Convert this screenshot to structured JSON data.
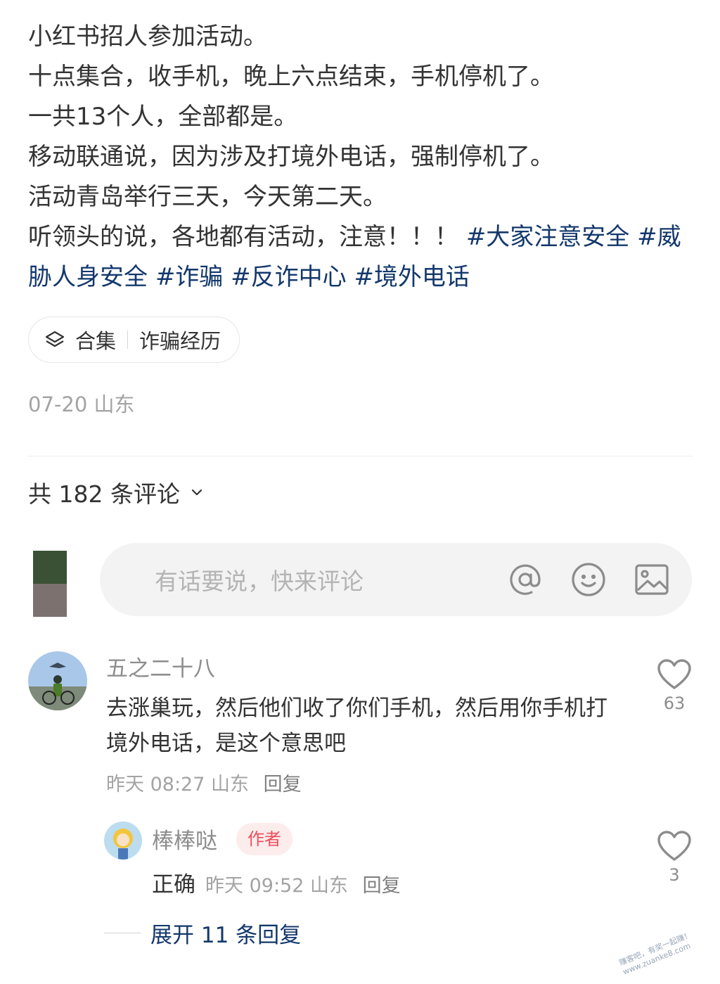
{
  "post": {
    "lines": [
      "小红书招人参加活动。",
      "十点集合，收手机，晚上六点结束，手机停机了。",
      "一共13个人，全部都是。",
      "移动联通说，因为涉及打境外电话，强制停机了。",
      "活动青岛举行三天，今天第二天。"
    ],
    "last_line_prefix": "听领头的说，各地都有活动，注意！！！ ",
    "hashtags": [
      "#大家注意安全",
      "#威胁人身安全",
      "#诈骗",
      "#反诈中心",
      "#境外电话"
    ]
  },
  "collection": {
    "icon": "layers-icon",
    "label": "合集",
    "name": "诈骗经历"
  },
  "meta": {
    "date": "07-20",
    "location": "山东"
  },
  "comments_header": {
    "label": "共 182 条评论"
  },
  "comment_input": {
    "placeholder": "有话要说，快来评论",
    "icons": [
      "at-icon",
      "emoji-icon",
      "image-icon"
    ]
  },
  "comment": {
    "username": "五之二十八",
    "text": "去涨巢玩，然后他们收了你们手机，然后用你手机打境外电话，是这个意思吧",
    "time": "昨天 08:27",
    "location": "山东",
    "reply_label": "回复",
    "likes": "63"
  },
  "reply": {
    "username": "棒棒哒",
    "badge": "作者",
    "text": "正确",
    "time": "昨天 09:52",
    "location": "山东",
    "reply_label": "回复",
    "likes": "3"
  },
  "expand_replies": {
    "label": "展开 11 条回复"
  },
  "watermark": {
    "line1": "赚客吧，有奖一起赚！",
    "line2": "www.zuanke8.com"
  },
  "colors": {
    "hashtag": "#13386c",
    "badge_text": "#ee4d5a",
    "badge_bg": "#fdecec"
  }
}
